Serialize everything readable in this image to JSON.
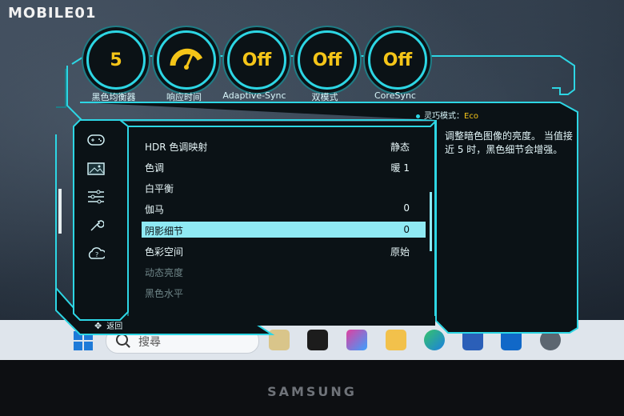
{
  "watermark": "MOBILE01",
  "gauges": [
    {
      "value": "5",
      "label": "黑色均衡器"
    },
    {
      "value": "",
      "label": "响应时间"
    },
    {
      "value": "Off",
      "label": "Adaptive-Sync"
    },
    {
      "value": "Off",
      "label": "双模式"
    },
    {
      "value": "Off",
      "label": "CoreSync"
    }
  ],
  "mode": {
    "label": "灵巧模式：",
    "value": "Eco"
  },
  "sidebar": [
    "gamepad-icon",
    "picture-icon",
    "sliders-icon",
    "wrench-icon",
    "help-cloud-icon"
  ],
  "menu": [
    {
      "label": "HDR 色调映射",
      "value": "静态"
    },
    {
      "label": "色调",
      "value": "暖 1"
    },
    {
      "label": "白平衡",
      "value": ""
    },
    {
      "label": "伽马",
      "value": "0"
    },
    {
      "label": "阴影细节",
      "value": "0",
      "selected": true
    },
    {
      "label": "色彩空间",
      "value": "原始"
    },
    {
      "label": "动态亮度",
      "value": ""
    },
    {
      "label": "黑色水平",
      "value": ""
    }
  ],
  "description": "调整暗色图像的亮度。 当值接近 5 时，黑色细节会增强。",
  "back_label": "返回",
  "taskbar": {
    "search_placeholder": "搜尋"
  },
  "brand": "SAMSUNG",
  "colors": {
    "accent": "#2dd6e4",
    "highlight": "#8fe9f3",
    "gold": "#f5c518"
  }
}
